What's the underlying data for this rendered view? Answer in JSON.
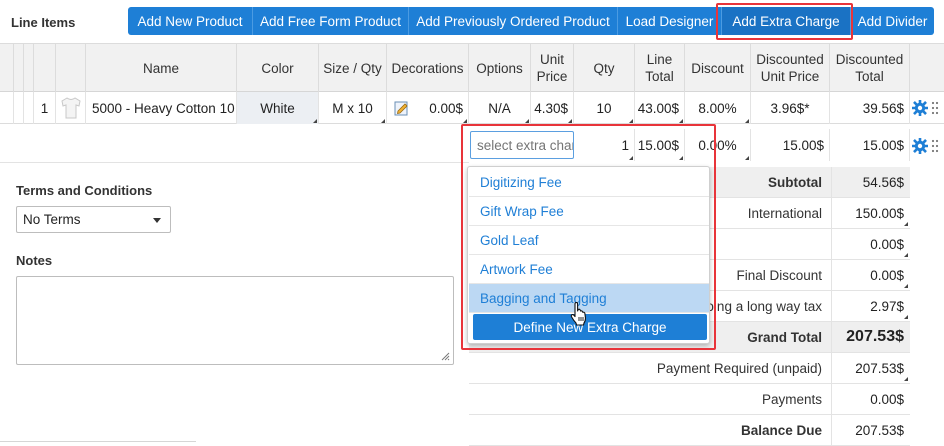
{
  "header": {
    "title": "Line Items",
    "buttons": [
      "Add New Product",
      "Add Free Form Product",
      "Add Previously Ordered Product",
      "Load Designer",
      "Add Extra Charge",
      "Add Divider"
    ]
  },
  "columns": {
    "name": "Name",
    "color": "Color",
    "size_qty": "Size / Qty",
    "decorations": "Decorations",
    "options": "Options",
    "unit_price": "Unit Price",
    "qty": "Qty",
    "line_total": "Line Total",
    "discount": "Discount",
    "discounted_unit_price": "Discounted Unit Price",
    "discounted_total": "Discounted Total"
  },
  "line_item": {
    "index": "1",
    "name": "5000 - Heavy Cotton 10",
    "color": "White",
    "size_qty": "M x 10",
    "decorations_price": "0.00$",
    "options": "N/A",
    "unit_price": "4.30$",
    "qty": "10",
    "line_total": "43.00$",
    "discount": "8.00%",
    "discounted_unit_price": "3.96$*",
    "discounted_total": "39.56$"
  },
  "extra_charge_row": {
    "placeholder": "select extra charge",
    "qty": "1",
    "price": "15.00$",
    "discount": "0.00%",
    "discounted_unit_price": "15.00$",
    "discounted_total": "15.00$"
  },
  "left_panel": {
    "terms_label": "Terms and Conditions",
    "terms_value": "No Terms",
    "notes_label": "Notes"
  },
  "totals": [
    {
      "label": "Subtotal",
      "value": "54.56$"
    },
    {
      "label": "International",
      "value": "150.00$"
    },
    {
      "label": "",
      "value": "0.00$"
    },
    {
      "label": "Final Discount",
      "value": "0.00$"
    },
    {
      "label": "Going a long way tax",
      "value": "2.97$"
    },
    {
      "label": "Grand Total",
      "value": "207.53$"
    },
    {
      "label": "Payment Required (unpaid)",
      "value": "207.53$"
    },
    {
      "label": "Payments",
      "value": "0.00$"
    },
    {
      "label": "Balance Due",
      "value": "207.53$"
    }
  ],
  "dropdown": {
    "items": [
      "Digitizing Fee",
      "Gift Wrap Fee",
      "Gold Leaf",
      "Artwork Fee",
      "Bagging and Tagging"
    ],
    "active_item": "Bagging and Tagging",
    "define_button": "Define New Extra Charge"
  },
  "colors": {
    "accent": "#1e7fd6",
    "highlight_border": "#e8343a",
    "header_bg": "#f1f1f1",
    "hover_item": "#bcd8f3"
  }
}
